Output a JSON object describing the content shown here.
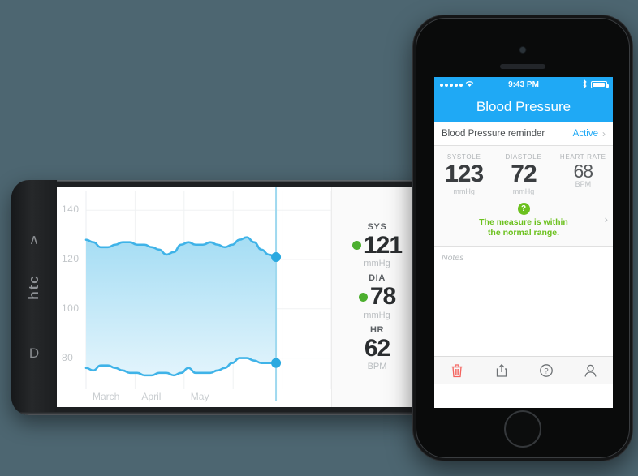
{
  "background_color": "#4d6671",
  "android": {
    "brand": "htc",
    "nav": {
      "back_icon": "chevron-up-icon",
      "back_glyph": "∧",
      "recent_icon": "recent-apps-icon",
      "recent_glyph": "D"
    },
    "stats": [
      {
        "label": "SYS",
        "value": "121",
        "unit": "mmHg",
        "dot_color": "#4caf2f",
        "has_dot": true
      },
      {
        "label": "DIA",
        "value": "78",
        "unit": "mmHg",
        "dot_color": "#4caf2f",
        "has_dot": true
      },
      {
        "label": "HR",
        "value": "62",
        "unit": "BPM",
        "has_dot": false
      }
    ]
  },
  "chart_data": {
    "type": "area",
    "title": "",
    "xlabel": "",
    "ylabel": "",
    "ylim": [
      70,
      145
    ],
    "y_ticks": [
      "140",
      "120",
      "100",
      "80"
    ],
    "y_tick_values": [
      140,
      120,
      100,
      80
    ],
    "x_ticks": [
      "March",
      "April",
      "May"
    ],
    "grid": true,
    "legend_position": "none",
    "line_color": "#3fb3e8",
    "fill_color_top": "#a5ddf4",
    "fill_color_bottom": "#ddf2fb",
    "marker_color": "#2aa9e0",
    "selection_line_color": "#9fd9ef",
    "selected_systolic": 121,
    "selected_diastolic": 78,
    "series": [
      {
        "name": "Systolic",
        "values": [
          128,
          127,
          125,
          125,
          126,
          127,
          127,
          126,
          126,
          125,
          124,
          122,
          123,
          126,
          127,
          126,
          126,
          127,
          126,
          125,
          126,
          128,
          129,
          127,
          124,
          122,
          121
        ]
      },
      {
        "name": "Diastolic",
        "values": [
          76,
          75,
          77,
          77,
          76,
          75,
          74,
          74,
          73,
          73,
          74,
          74,
          73,
          74,
          76,
          74,
          74,
          74,
          75,
          76,
          78,
          80,
          80,
          79,
          78,
          78,
          78
        ]
      }
    ]
  },
  "iphone": {
    "status_bar": {
      "signal_icon": "signal-dots-icon",
      "wifi_icon": "wifi-icon",
      "time": "9:43 PM",
      "bluetooth_icon": "bluetooth-icon",
      "battery_icon": "battery-icon"
    },
    "nav": {
      "title": "Blood Pressure"
    },
    "reminder": {
      "label": "Blood Pressure reminder",
      "status": "Active",
      "chevron_icon": "chevron-right-icon",
      "chevron_glyph": "›",
      "status_color": "#1fa9f5"
    },
    "measurements": [
      {
        "label": "SYSTOLE",
        "value": "123",
        "unit": "mmHg"
      },
      {
        "label": "DIASTOLE",
        "value": "72",
        "unit": "mmHg"
      },
      {
        "label": "HEART RATE",
        "value": "68",
        "unit": "BPM"
      }
    ],
    "status_message": {
      "badge_icon": "question-mark-badge-icon",
      "badge_glyph": "?",
      "line1": "The measure is within",
      "line2": "the normal range.",
      "color": "#6cc11e",
      "chevron_glyph": "›"
    },
    "notes": {
      "placeholder": "Notes",
      "value": ""
    },
    "toolbar": [
      {
        "name": "delete-icon",
        "label": "Delete",
        "color": "#f4615c"
      },
      {
        "name": "share-icon",
        "label": "Share",
        "color": "#6e7275"
      },
      {
        "name": "help-icon",
        "label": "Help",
        "color": "#6e7275"
      },
      {
        "name": "account-icon",
        "label": "Account",
        "color": "#6e7275"
      }
    ]
  }
}
